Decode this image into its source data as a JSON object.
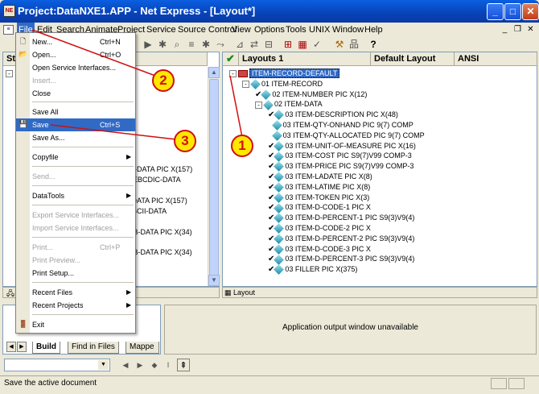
{
  "window": {
    "title": "Project:DataNXE1.APP - Net Express - [Layout*]",
    "app_icon": "NE"
  },
  "menubar": {
    "items": [
      "File",
      "Edit",
      "Search",
      "Animate",
      "Project",
      "Service",
      "Source Control",
      "View",
      "Options",
      "Tools",
      "UNIX",
      "Window",
      "Help"
    ]
  },
  "file_menu": {
    "items": [
      {
        "label": "New...",
        "shortcut": "Ctrl+N",
        "icon": "new-doc-icon"
      },
      {
        "label": "Open...",
        "shortcut": "Ctrl+O",
        "icon": "open-folder-icon"
      },
      {
        "label": "Open Service Interfaces..."
      },
      {
        "label": "Insert...",
        "disabled": true
      },
      {
        "label": "Close"
      },
      {
        "label": "Save All"
      },
      {
        "label": "Save",
        "shortcut": "Ctrl+S",
        "icon": "floppy-disk-icon",
        "highlighted": true
      },
      {
        "label": "Save As..."
      },
      {
        "label": "Copyfile",
        "submenu": true
      },
      {
        "label": "Send...",
        "disabled": true
      },
      {
        "label": "DataTools",
        "submenu": true
      },
      {
        "label": "Export Service Interfaces...",
        "disabled": true
      },
      {
        "label": "Import Service Interfaces...",
        "disabled": true
      },
      {
        "label": "Print...",
        "shortcut": "Ctrl+P",
        "disabled": true
      },
      {
        "label": "Print Preview...",
        "disabled": true
      },
      {
        "label": "Print Setup..."
      },
      {
        "label": "Recent Files",
        "submenu": true
      },
      {
        "label": "Recent Projects",
        "submenu": true
      },
      {
        "label": "Exit",
        "icon": "exit-door-icon"
      }
    ]
  },
  "left_pane": {
    "header": "Str",
    "fragments": [
      "IC-DATA PIC X(157)",
      "s EBCDIC-DATA",
      "I-DATA PIC X(157)",
      "ASCII-DATA",
      "MB-DATA PIC X(34)",
      "MB-DATA PIC X(34)"
    ],
    "tab": "Layout"
  },
  "layout_pane": {
    "columns": [
      "Layouts 1",
      "Default Layout",
      "ANSI"
    ],
    "tree": [
      {
        "label": "ITEM-RECORD-DEFAULT",
        "level": 0,
        "root": true
      },
      {
        "label": "01 ITEM-RECORD",
        "level": 1
      },
      {
        "label": "02 ITEM-NUMBER PIC X(12)",
        "level": 2,
        "check": true
      },
      {
        "label": "02 ITEM-DATA",
        "level": 2
      },
      {
        "label": "03 ITEM-DESCRIPTION PIC X(48)",
        "level": 3,
        "check": true
      },
      {
        "label": "03 ITEM-QTY-ONHAND PIC 9(7) COMP",
        "level": 3,
        "check": false
      },
      {
        "label": "03 ITEM-QTY-ALLOCATED PIC 9(7) COMP",
        "level": 3,
        "check": false
      },
      {
        "label": "03 ITEM-UNIT-OF-MEASURE PIC X(16)",
        "level": 3,
        "check": true
      },
      {
        "label": "03 ITEM-COST PIC S9(7)V99 COMP-3",
        "level": 3,
        "check": true
      },
      {
        "label": "03 ITEM-PRICE PIC S9(7)V99 COMP-3",
        "level": 3,
        "check": true
      },
      {
        "label": "03 ITEM-LADATE PIC X(8)",
        "level": 3,
        "check": true
      },
      {
        "label": "03 ITEM-LATIME PIC X(8)",
        "level": 3,
        "check": true
      },
      {
        "label": "03 ITEM-TOKEN PIC X(3)",
        "level": 3,
        "check": true
      },
      {
        "label": "03 ITEM-D-CODE-1 PIC X",
        "level": 3,
        "check": true
      },
      {
        "label": "03 ITEM-D-PERCENT-1 PIC S9(3)V9(4)",
        "level": 3,
        "check": true
      },
      {
        "label": "03 ITEM-D-CODE-2 PIC X",
        "level": 3,
        "check": true
      },
      {
        "label": "03 ITEM-D-PERCENT-2 PIC S9(3)V9(4)",
        "level": 3,
        "check": true
      },
      {
        "label": "03 ITEM-D-CODE-3 PIC X",
        "level": 3,
        "check": true
      },
      {
        "label": "03 ITEM-D-PERCENT-3 PIC S9(3)V9(4)",
        "level": 3,
        "check": true
      },
      {
        "label": "03 FILLER PIC X(375)",
        "level": 3,
        "check": true
      }
    ]
  },
  "output": {
    "message": "Application output window unavailable",
    "tabs": [
      "Build",
      "Find in Files",
      "Mappe"
    ]
  },
  "callouts": [
    "1",
    "2",
    "3"
  ],
  "statusbar": {
    "text": "Save the active document"
  },
  "colors": {
    "title_blue": "#0a5fe0",
    "selection": "#316ac5",
    "callout_fill": "#ffe800",
    "callout_stroke": "#d01010"
  }
}
